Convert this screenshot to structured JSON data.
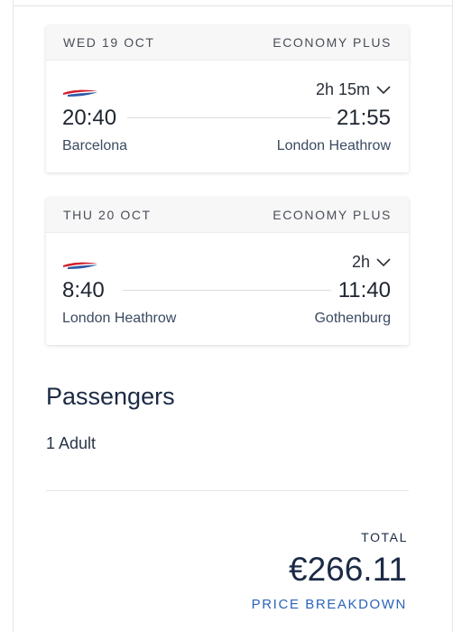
{
  "flights": [
    {
      "date": "WED 19 OCT",
      "cabin": "ECONOMY PLUS",
      "duration": "2h 15m",
      "depart_time": "20:40",
      "arrive_time": "21:55",
      "origin": "Barcelona",
      "destination": "London Heathrow"
    },
    {
      "date": "THU 20 OCT",
      "cabin": "ECONOMY PLUS",
      "duration": "2h",
      "depart_time": "8:40",
      "arrive_time": "11:40",
      "origin": "London Heathrow",
      "destination": "Gothenburg"
    }
  ],
  "passengers": {
    "title": "Passengers",
    "summary": "1 Adult"
  },
  "total": {
    "label": "TOTAL",
    "amount": "€266.11",
    "breakdown_link": "PRICE BREAKDOWN"
  },
  "icons": {
    "airline": "airline-speedmarque-icon",
    "expand": "chevron-down-icon"
  },
  "colors": {
    "link": "#2c64b8",
    "logo_red": "#d3202e",
    "logo_blue": "#2e5aa8",
    "text_dark": "#1b2a45"
  }
}
